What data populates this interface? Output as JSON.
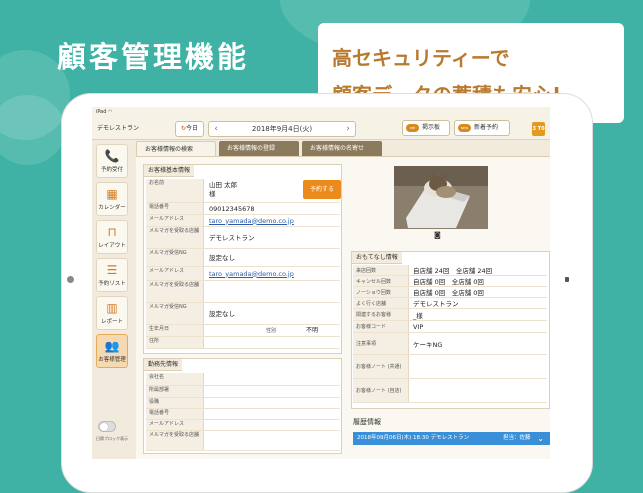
{
  "promo": {
    "title": "顧客管理機能",
    "bubble_line1": "高セキュリティーで",
    "bubble_line2": "顧客データの蓄積も安心!"
  },
  "status_bar": {
    "device": "iPad",
    "wifi_icon": "wifi-icon"
  },
  "header": {
    "store_name": "デモレストラン",
    "today_label": "今日",
    "date": "2018年9月4日(火)",
    "date_short": "今",
    "bulletin_label": "掲示板",
    "bulletin_badge": "PPP",
    "new_reservation_label": "新着予約",
    "new_badge": "NEW",
    "corner_label": "3\nT0"
  },
  "sidebar": {
    "items": [
      {
        "label": "予約受付",
        "icon": "phone-icon",
        "glyph": "📞"
      },
      {
        "label": "カレンダー",
        "icon": "calendar-icon",
        "glyph": "▦"
      },
      {
        "label": "レイアウト",
        "icon": "table-layout-icon",
        "glyph": "⊓"
      },
      {
        "label": "予約リスト",
        "icon": "list-icon",
        "glyph": "☰"
      },
      {
        "label": "レポート",
        "icon": "chart-icon",
        "glyph": "▥"
      },
      {
        "label": "お客様管理",
        "icon": "customers-icon",
        "glyph": "👥"
      }
    ],
    "toggle_label": "日際ブロック表示"
  },
  "tabs": [
    {
      "label": "お客様情報の検索"
    },
    {
      "label": "お客様情報の登録"
    },
    {
      "label": "お客様情報の名寄せ"
    }
  ],
  "basic_info": {
    "heading": "お客様基本情報",
    "reserve_button": "予約する",
    "rows": [
      {
        "label": "お名前",
        "value": "山田 太郎\n様"
      },
      {
        "label": "電話番号",
        "value": "09012345678"
      },
      {
        "label": "メールアドレス",
        "value": "taro_yamada@demo.co.jp"
      },
      {
        "label": "メルマガを受取る店舗",
        "value": "デモレストラン"
      },
      {
        "label": "メルマガ受信NG",
        "value": "設定なし"
      },
      {
        "label": "メールアドレス",
        "value": "taro_yamada@demo.co.jp"
      },
      {
        "label": "メルマガを受取る店舗",
        "value": ""
      },
      {
        "label": "メルマガ受信NG",
        "value": "設定なし"
      },
      {
        "label": "生年月日",
        "value": "",
        "extra_label": "性別",
        "extra_value": "不明"
      },
      {
        "label": "住所",
        "value": ""
      }
    ]
  },
  "work_info": {
    "heading": "勤務先情報",
    "rows": [
      {
        "label": "会社名"
      },
      {
        "label": "所属部署"
      },
      {
        "label": "役職"
      },
      {
        "label": "電話番号"
      },
      {
        "label": "メールアドレス"
      },
      {
        "label": "メルマガを受取る店舗"
      }
    ]
  },
  "hospitality": {
    "heading": "おもてなし情報",
    "rows": [
      {
        "label": "来店回数",
        "value": "自店舗 24回　全店舗 24回"
      },
      {
        "label": "キャンセル回数",
        "value": "自店舗 0回　全店舗 0回"
      },
      {
        "label": "ノーショウ回数",
        "value": "自店舗 0回　全店舗 0回"
      },
      {
        "label": "よく行く店舗",
        "value": "デモレストラン"
      },
      {
        "label": "関連するお客様",
        "value": "_様"
      },
      {
        "label": "お客様コード",
        "value": "VIP"
      },
      {
        "label": "注意事項",
        "value": "ケーキNG"
      },
      {
        "label": "お客様ノート (共通)",
        "value": ""
      },
      {
        "label": "お客様ノート (自店)",
        "value": ""
      }
    ]
  },
  "history": {
    "heading": "履歴情報",
    "entry": "2018年09月06日(木) 18:30 デモレストラン",
    "entry_extra": "担当：佐藤"
  }
}
